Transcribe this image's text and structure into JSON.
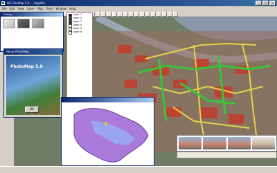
{
  "window": {
    "title": "GIS Desktop 5.0 — Logroño"
  },
  "menu": [
    "File",
    "Edit",
    "View",
    "Layer",
    "Map",
    "Tools",
    "Window",
    "Help"
  ],
  "toolbar_count": 32,
  "catalog_window": {
    "title": "Catalog"
  },
  "layer_panel": {
    "items": [
      {
        "label": "Layer 1",
        "checked": true
      },
      {
        "label": "Layer 2",
        "checked": true
      },
      {
        "label": "Layer 3",
        "checked": true
      },
      {
        "label": "Layer 4",
        "checked": false
      },
      {
        "label": "Layer 5",
        "checked": false
      },
      {
        "label": "Layer 6",
        "checked": false
      }
    ]
  },
  "about_window": {
    "title": "About PhotoMap",
    "product": "PhotoMap 5.0",
    "subtitle": "",
    "ok_label": "OK"
  },
  "region_window": {
    "title": ""
  },
  "bottom_strip": {
    "label": ""
  },
  "statusbar": {
    "text": ""
  },
  "colors": {
    "title_gradient_start": "#0a246a",
    "title_gradient_end": "#3a6ea5",
    "road_green": "#38c538",
    "road_yellow": "#e8d44a",
    "building_red": "#c43b2b",
    "river_gray": "#7f8f9e"
  }
}
